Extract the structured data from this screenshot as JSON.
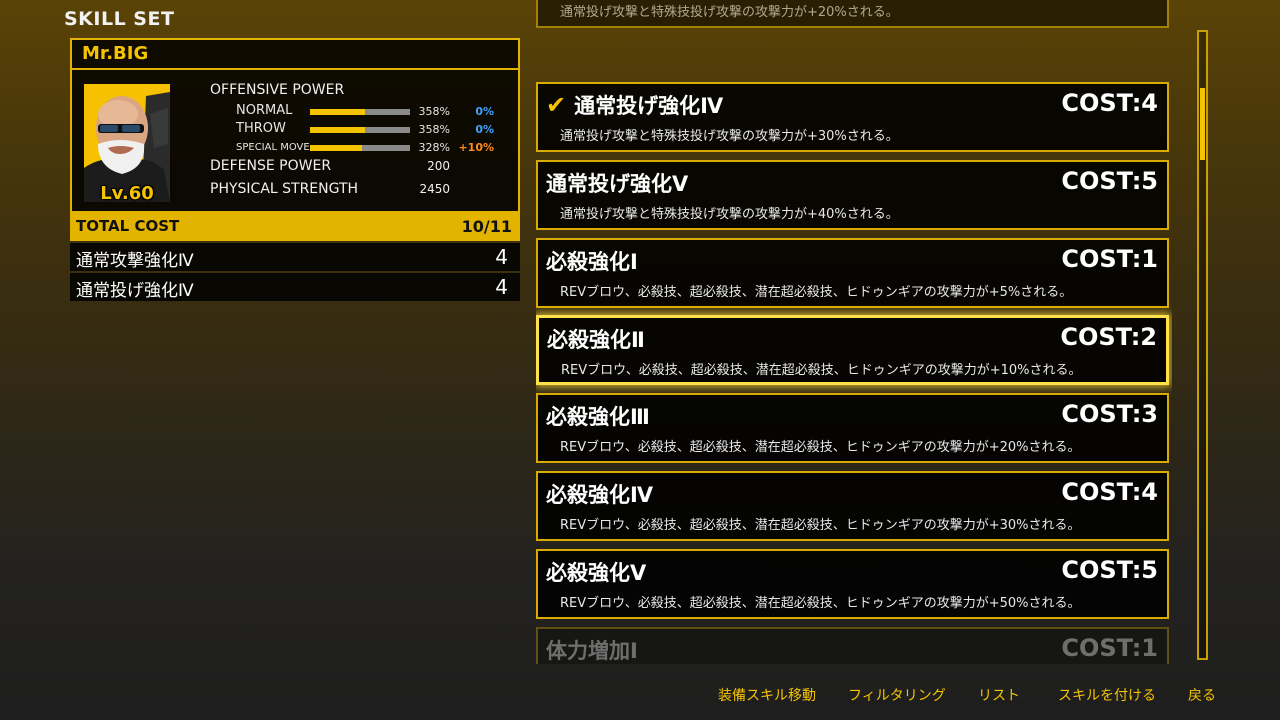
{
  "screen_title": "SKILL SET",
  "character": {
    "name": "Mr.BIG",
    "level": "Lv.60",
    "offensive_power_label": "OFFENSIVE POWER",
    "offense": [
      {
        "label": "NORMAL",
        "value": "358%",
        "bonus": "0%",
        "bonus_color": "#3ea2ff",
        "fill": 0.55
      },
      {
        "label": "THROW",
        "value": "358%",
        "bonus": "0%",
        "bonus_color": "#3ea2ff",
        "fill": 0.55
      },
      {
        "label": "SPECIAL MOVE",
        "value": "328%",
        "bonus": "+10%",
        "bonus_color": "#ff8a1c",
        "fill": 0.52
      }
    ],
    "defense_label": "DEFENSE POWER",
    "defense_value": "200",
    "physical_label": "PHYSICAL STRENGTH",
    "physical_value": "2450"
  },
  "total_cost": {
    "label": "TOTAL COST",
    "value": "10/11"
  },
  "equipped": [
    {
      "name": "通常攻撃強化Ⅳ",
      "cost": "4"
    },
    {
      "name": "通常投げ強化Ⅳ",
      "cost": "4"
    }
  ],
  "skills": [
    {
      "name": "",
      "cost": "",
      "desc": "通常投げ攻撃と特殊技投げ攻撃の攻撃力が+20%される。",
      "checked": false,
      "selected": false,
      "partial": "top"
    },
    {
      "name": "通常投げ強化Ⅳ",
      "cost": "COST:4",
      "desc": "通常投げ攻撃と特殊技投げ攻撃の攻撃力が+30%される。",
      "checked": true,
      "selected": false
    },
    {
      "name": "通常投げ強化Ⅴ",
      "cost": "COST:5",
      "desc": "通常投げ攻撃と特殊技投げ攻撃の攻撃力が+40%される。",
      "checked": false,
      "selected": false
    },
    {
      "name": "必殺強化Ⅰ",
      "cost": "COST:1",
      "desc": "REVブロウ、必殺技、超必殺技、潜在超必殺技、ヒドゥンギアの攻撃力が+5%される。",
      "checked": false,
      "selected": false
    },
    {
      "name": "必殺強化Ⅱ",
      "cost": "COST:2",
      "desc": "REVブロウ、必殺技、超必殺技、潜在超必殺技、ヒドゥンギアの攻撃力が+10%される。",
      "checked": false,
      "selected": true
    },
    {
      "name": "必殺強化Ⅲ",
      "cost": "COST:3",
      "desc": "REVブロウ、必殺技、超必殺技、潜在超必殺技、ヒドゥンギアの攻撃力が+20%される。",
      "checked": false,
      "selected": false
    },
    {
      "name": "必殺強化Ⅳ",
      "cost": "COST:4",
      "desc": "REVブロウ、必殺技、超必殺技、潜在超必殺技、ヒドゥンギアの攻撃力が+30%される。",
      "checked": false,
      "selected": false
    },
    {
      "name": "必殺強化Ⅴ",
      "cost": "COST:5",
      "desc": "REVブロウ、必殺技、超必殺技、潜在超必殺技、ヒドゥンギアの攻撃力が+50%される。",
      "checked": false,
      "selected": false
    },
    {
      "name": "体力増加Ⅰ",
      "cost": "COST:1",
      "desc": "",
      "checked": false,
      "selected": false,
      "partial": "bottom"
    }
  ],
  "footer_hints": [
    "装備スキル移動",
    "フィルタリング",
    "リスト",
    "スキルを付ける",
    "戻る"
  ]
}
